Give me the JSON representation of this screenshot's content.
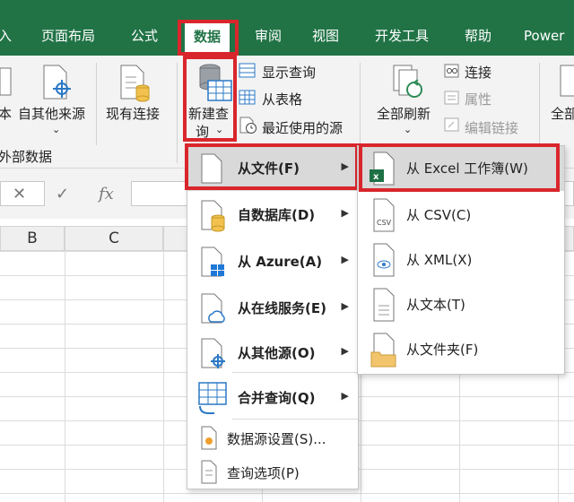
{
  "tabs": [
    "入",
    "页面布局",
    "公式",
    "数据",
    "审阅",
    "视图",
    "开发工具",
    "帮助",
    "Power"
  ],
  "ribbon": {
    "get_data_partial": "本",
    "from_other_sources": "自其他来源",
    "existing_connections": "现有连接",
    "new_query_line1": "新建查",
    "new_query_line2": "询",
    "group_label": "外部数据",
    "show_queries": "显示查询",
    "from_table": "从表格",
    "recent_sources": "最近使用的源",
    "refresh_all": "全部刷新",
    "connections": "连接",
    "properties": "属性",
    "edit_links": "编辑链接",
    "right_partial": "全部"
  },
  "formula_bar": {
    "cancel": "✕",
    "enter": "✓",
    "fx": "fx"
  },
  "columns": [
    "B",
    "C"
  ],
  "menu": {
    "items": [
      {
        "label": "从文件(F)",
        "has_sub": true
      },
      {
        "label": "自数据库(D)",
        "has_sub": true
      },
      {
        "label": "从 Azure(A)",
        "has_sub": true
      },
      {
        "label": "从在线服务(E)",
        "has_sub": true
      },
      {
        "label": "从其他源(O)",
        "has_sub": true
      },
      {
        "label": "合并查询(Q)",
        "has_sub": true
      },
      {
        "label": "数据源设置(S)...",
        "has_sub": false
      },
      {
        "label": "查询选项(P)",
        "has_sub": false
      }
    ]
  },
  "submenu": {
    "items": [
      {
        "label": "从 Excel 工作簿(W)",
        "icon": "excel-file-icon"
      },
      {
        "label": "从 CSV(C)",
        "icon": "csv-file-icon"
      },
      {
        "label": "从 XML(X)",
        "icon": "xml-file-icon"
      },
      {
        "label": "从文本(T)",
        "icon": "text-file-icon"
      },
      {
        "label": "从文件夹(F)",
        "icon": "folder-icon"
      }
    ]
  },
  "colors": {
    "accent": "#217346",
    "highlight": "#d9262c"
  }
}
